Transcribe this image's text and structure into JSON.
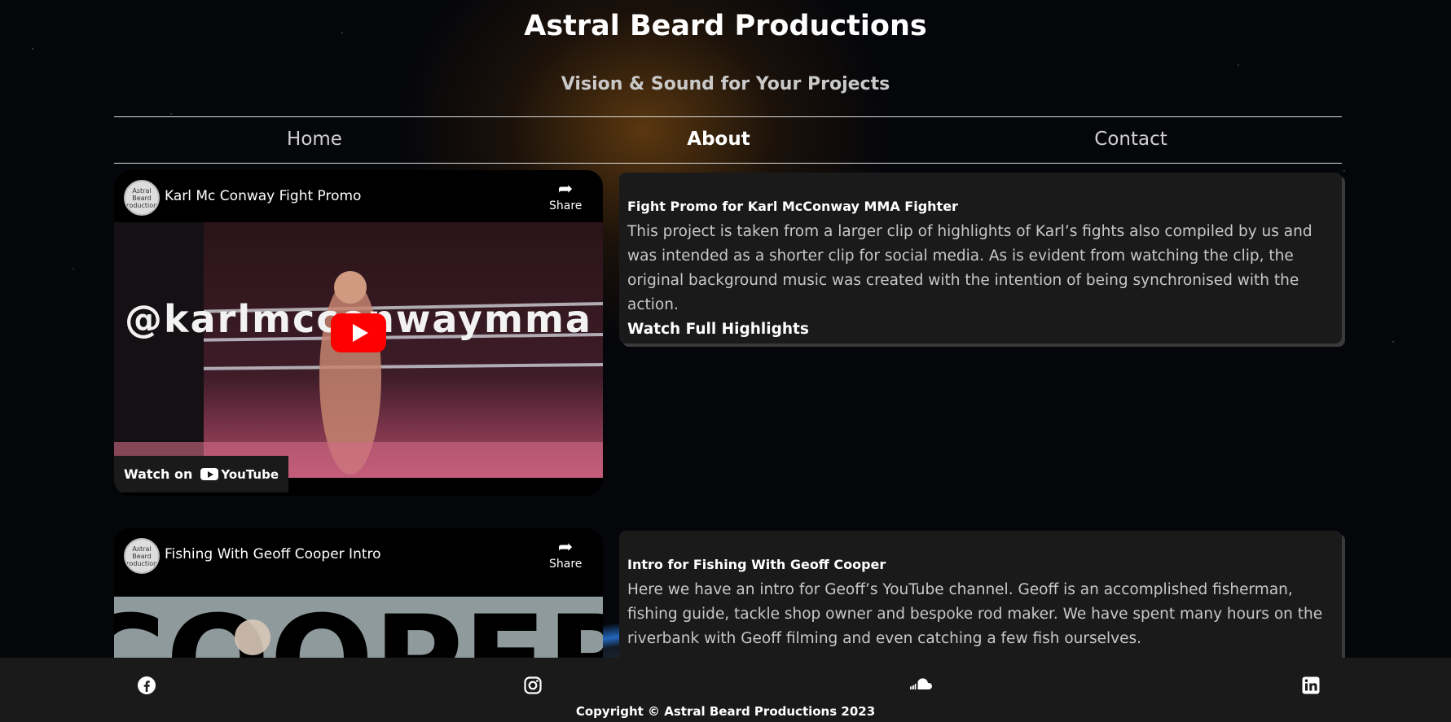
{
  "header": {
    "title": "Astral Beard Productions",
    "tagline": "Vision & Sound for Your Projects"
  },
  "nav": {
    "items": [
      "Home",
      "About",
      "Contact"
    ],
    "active": "About"
  },
  "videos": [
    {
      "title": "Karl Mc Conway Fight Promo",
      "channel_avatar_text": "Astral Beard Productions",
      "share_label": "Share",
      "overlay_text": "@karlmcconwaymma",
      "watch_on_label": "Watch on",
      "youtube_label": "YouTube"
    },
    {
      "title": "Fishing With Geoff Cooper Intro",
      "channel_avatar_text": "Astral Beard Productions",
      "share_label": "Share",
      "overlay_text": "COOPER"
    }
  ],
  "cards": [
    {
      "title": "Fight Promo for Karl McConway MMA Fighter",
      "body": "This project is taken from a larger clip of highlights of Karl’s fights also compiled by us and was intended as a shorter clip for social media. As is evident from watching the clip, the original background music was created with the intention of being synchronised with the action.",
      "link": "Watch Full Highlights"
    },
    {
      "title": "Intro for Fishing With Geoff Cooper",
      "body": "Here we have an intro for Geoff’s YouTube channel. Geoff is an accomplished fisherman, fishing guide, tackle shop owner and bespoke rod maker. We have spent many hours on the riverbank with Geoff filming and even catching a few fish ourselves."
    }
  ],
  "footer": {
    "icons": [
      "facebook-icon",
      "instagram-icon",
      "soundcloud-icon",
      "linkedin-icon"
    ],
    "copyright": "Copyright © Astral Beard Productions 2023"
  },
  "colors": {
    "card_bg": "#1b1a1b",
    "footer_bg": "#1b1a1b",
    "youtube_red": "#ff0000"
  }
}
